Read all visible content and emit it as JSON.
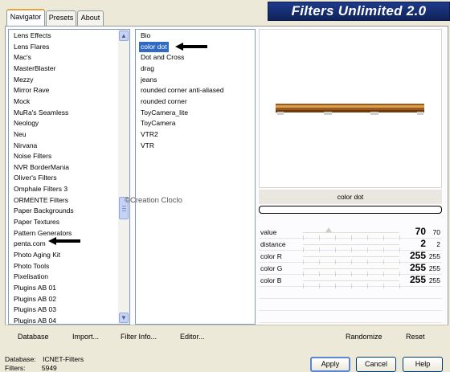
{
  "tabs": [
    {
      "label": "Navigator",
      "active": true
    },
    {
      "label": "Presets",
      "active": false
    },
    {
      "label": "About",
      "active": false
    }
  ],
  "banner_title": "Filters Unlimited 2.0",
  "categories": [
    "Lens Effects",
    "Lens Flares",
    "Mac's",
    "MasterBlaster",
    "Mezzy",
    "Mirror Rave",
    "Mock",
    "MuRa's Seamless",
    "Neology",
    "Neu",
    "Nirvana",
    "Noise Filters",
    "NVR BorderMania",
    "Oliver's Filters",
    "Omphale Filters 3",
    "ORMENTE Filters",
    "Paper Backgrounds",
    "Paper Textures",
    "Pattern Generators",
    "penta.com",
    "Photo Aging Kit",
    "Photo Tools",
    "Pixelisation",
    "Plugins AB 01",
    "Plugins AB 02",
    "Plugins AB 03",
    "Plugins AB 04"
  ],
  "filters": [
    "Bio",
    "color dot",
    "Dot and Cross",
    "drag",
    "jeans",
    "rounded corner anti-aliased",
    "rounded corner",
    "ToyCamera_lite",
    "ToyCamera",
    "VTR2",
    "VTR"
  ],
  "selected_filter": "color dot",
  "watermark": "©Creation Cloclo",
  "preview_filter_name": "color dot",
  "params": [
    {
      "label": "value",
      "value": "70",
      "small": "70",
      "level": 0.27
    },
    {
      "label": "distance",
      "value": "2",
      "small": "2",
      "level": 0.0
    },
    {
      "label": "color R",
      "value": "255",
      "small": "255",
      "level": 1.0
    },
    {
      "label": "color G",
      "value": "255",
      "small": "255",
      "level": 1.0
    },
    {
      "label": "color B",
      "value": "255",
      "small": "255",
      "level": 1.0
    }
  ],
  "toolbar": {
    "database": "Database",
    "import": "Import...",
    "filter_info": "Filter Info...",
    "editor": "Editor...",
    "randomize": "Randomize",
    "reset": "Reset"
  },
  "status": {
    "database_label": "Database:",
    "database_value": "ICNET-Filters",
    "filters_label": "Filters:",
    "filters_value": "5949"
  },
  "buttons": {
    "apply": "Apply",
    "cancel": "Cancel",
    "help": "Help"
  },
  "colors": {
    "selection": "#316ac5",
    "banner": "#1e3a8a",
    "strip": "#b8742c"
  }
}
